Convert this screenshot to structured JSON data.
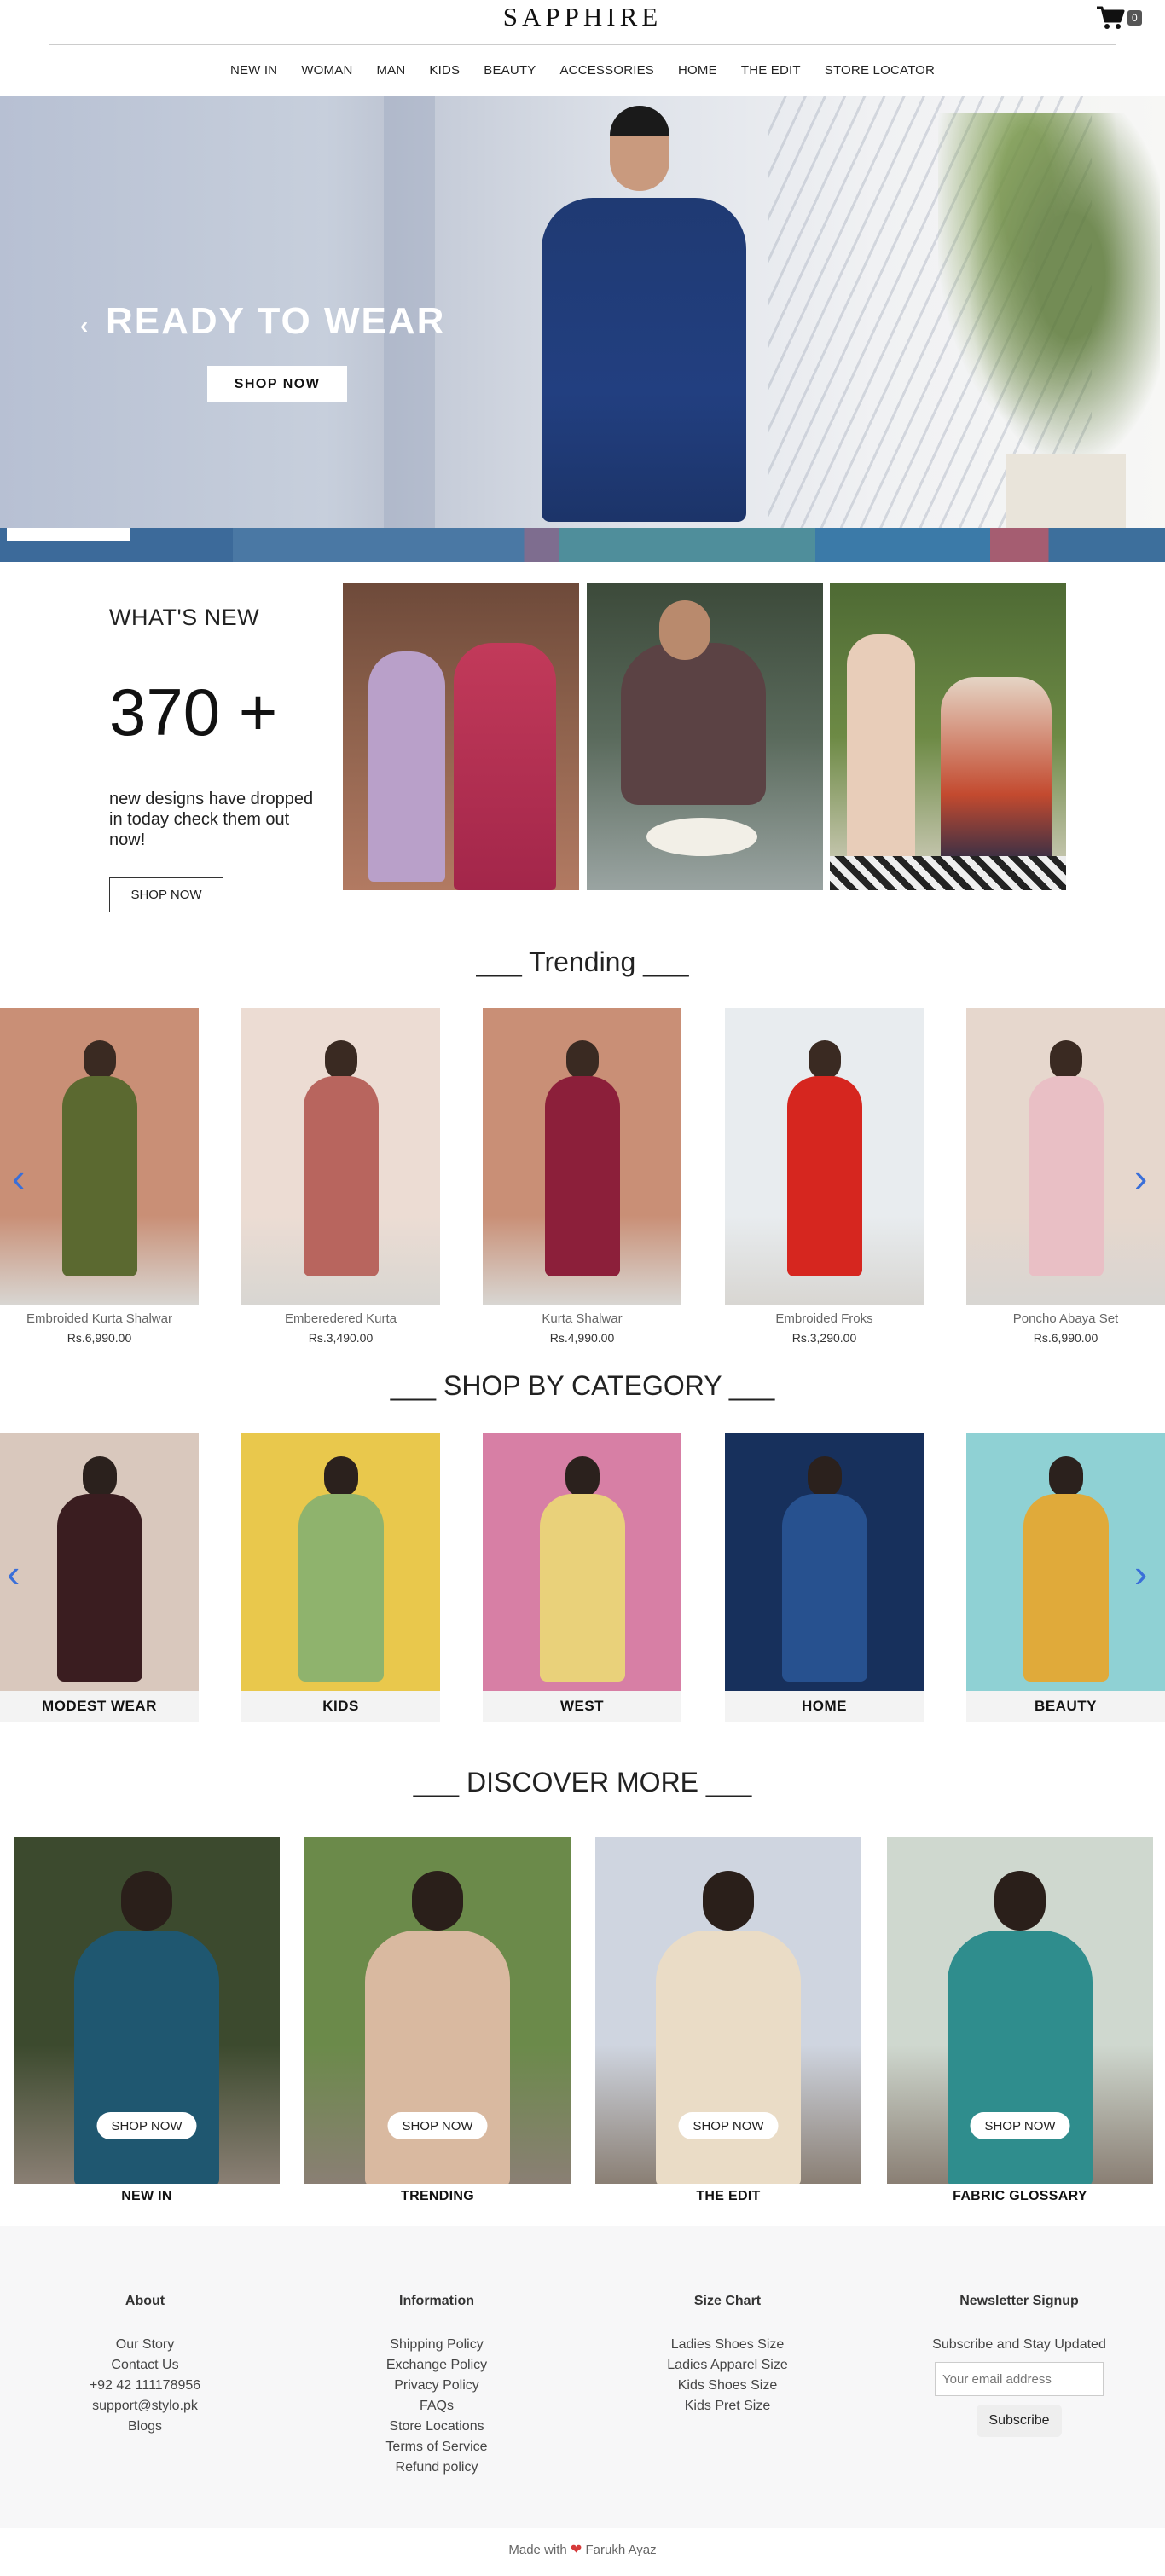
{
  "header": {
    "logo": "SAPPHIRE",
    "cart_count": "0",
    "nav": [
      "NEW IN",
      "WOMAN",
      "MAN",
      "KIDS",
      "BEAUTY",
      "ACCESSORIES",
      "HOME",
      "THE EDIT",
      "STORE LOCATOR"
    ]
  },
  "hero": {
    "title": "READY TO WEAR",
    "button": "SHOP NOW",
    "prev_icon": "‹"
  },
  "whats_new": {
    "title": "WHAT'S NEW",
    "count": "370 +",
    "description": "new designs have dropped in today check them out now!",
    "button": "SHOP NOW"
  },
  "trending": {
    "title": "___ Trending ___",
    "products": [
      {
        "name": "Embroided Kurta Shalwar",
        "price": "Rs.6,990.00",
        "bg": "#c98f76",
        "dress": "#5b6930"
      },
      {
        "name": "Emberedered Kurta",
        "price": "Rs.3,490.00",
        "bg": "#ecdcd3",
        "dress": "#b8655e"
      },
      {
        "name": "Kurta Shalwar",
        "price": "Rs.4,990.00",
        "bg": "#c98f76",
        "dress": "#8c1f3a"
      },
      {
        "name": "Embroided Froks",
        "price": "Rs.3,290.00",
        "bg": "#e8ecef",
        "dress": "#d6261f"
      },
      {
        "name": "Poncho Abaya Set",
        "price": "Rs.6,990.00",
        "bg": "#e6d7cd",
        "dress": "#e9bfc5"
      }
    ]
  },
  "shop_by_category": {
    "title": "___ SHOP BY CATEGORY ___",
    "categories": [
      {
        "label": "MODEST WEAR",
        "bg": "#d9c8bd",
        "dress": "#3a1d20"
      },
      {
        "label": "KIDS",
        "bg": "#e9c84c",
        "dress": "#8fb36d"
      },
      {
        "label": "WEST",
        "bg": "#d77fa5",
        "dress": "#e9d17a"
      },
      {
        "label": "HOME",
        "bg": "#17305c",
        "dress": "#27518f"
      },
      {
        "label": "BEAUTY",
        "bg": "#8fd1d4",
        "dress": "#e0aa3a"
      }
    ]
  },
  "discover_more": {
    "title": "___ DISCOVER MORE ___",
    "cards": [
      {
        "label": "NEW IN",
        "button": "SHOP NOW",
        "bg": "#3c4a2e",
        "dress": "#1f5770"
      },
      {
        "label": "TRENDING",
        "button": "SHOP NOW",
        "bg": "#6b8a4a",
        "dress": "#d9b9a0"
      },
      {
        "label": "THE EDIT",
        "button": "SHOP NOW",
        "bg": "#cfd5e0",
        "dress": "#eadcc6"
      },
      {
        "label": "FABRIC GLOSSARY",
        "button": "SHOP NOW",
        "bg": "#cfd8cf",
        "dress": "#2f8d8d"
      }
    ]
  },
  "footer": {
    "about": {
      "title": "About",
      "items": [
        "Our Story",
        "Contact Us",
        "+92 42 111178956",
        "support@stylo.pk",
        "Blogs"
      ]
    },
    "information": {
      "title": "Information",
      "items": [
        "Shipping Policy",
        "Exchange Policy",
        "Privacy Policy",
        "FAQs",
        "Store Locations",
        "Terms of Service",
        "Refund policy"
      ]
    },
    "size_chart": {
      "title": "Size Chart",
      "items": [
        "Ladies Shoes Size",
        "Ladies Apparel Size",
        "Kids Shoes Size",
        "Kids Pret Size"
      ]
    },
    "newsletter": {
      "title": "Newsletter Signup",
      "subtitle": "Subscribe and Stay Updated",
      "placeholder": "Your email address",
      "button": "Subscribe"
    },
    "made_with": "Made with",
    "author": "Farukh Ayaz"
  },
  "colors": {
    "accent_arrow": "#3a6fd9",
    "heart": "#d63b3b",
    "footer_bg": "#f7f7f8"
  }
}
